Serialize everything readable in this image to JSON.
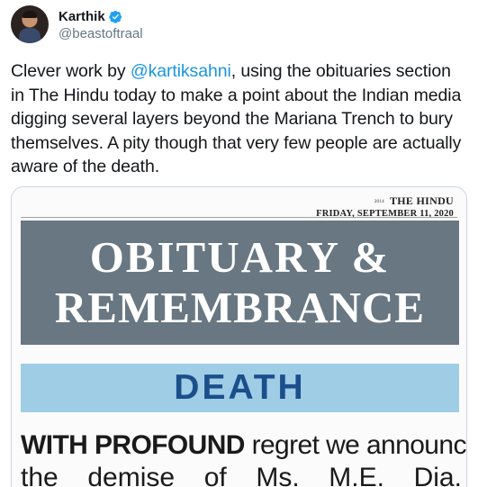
{
  "tweet": {
    "author_name": "Karthik",
    "author_handle": "@beastoftraal",
    "text_before": "Clever work by ",
    "mention": "@kartiksahni",
    "text_after": ", using the obituaries section in The Hindu today to make a point about the Indian media digging several layers beyond the Mariana Trench to bury themselves. A pity though that very few people are actually aware of the death."
  },
  "media": {
    "masthead": "THE HINDU",
    "masthead_prefix": "2014",
    "dateline": "FRIDAY, SEPTEMBER 11, 2020",
    "banner_line1": "OBITUARY &",
    "banner_line2": "REMEMBRANCE",
    "section": "DEATH",
    "body_bold": "WITH PROFOUND",
    "body_rest": " regret we announce",
    "body_words": [
      "the",
      "demise",
      "of",
      "Ms.",
      "M.E.",
      "Dia."
    ]
  },
  "colors": {
    "verified": "#1da1f2",
    "mention": "#1b95e0",
    "banner_bg": "#687782",
    "death_bg": "#9fcde6",
    "death_text": "#1b4f8c"
  }
}
